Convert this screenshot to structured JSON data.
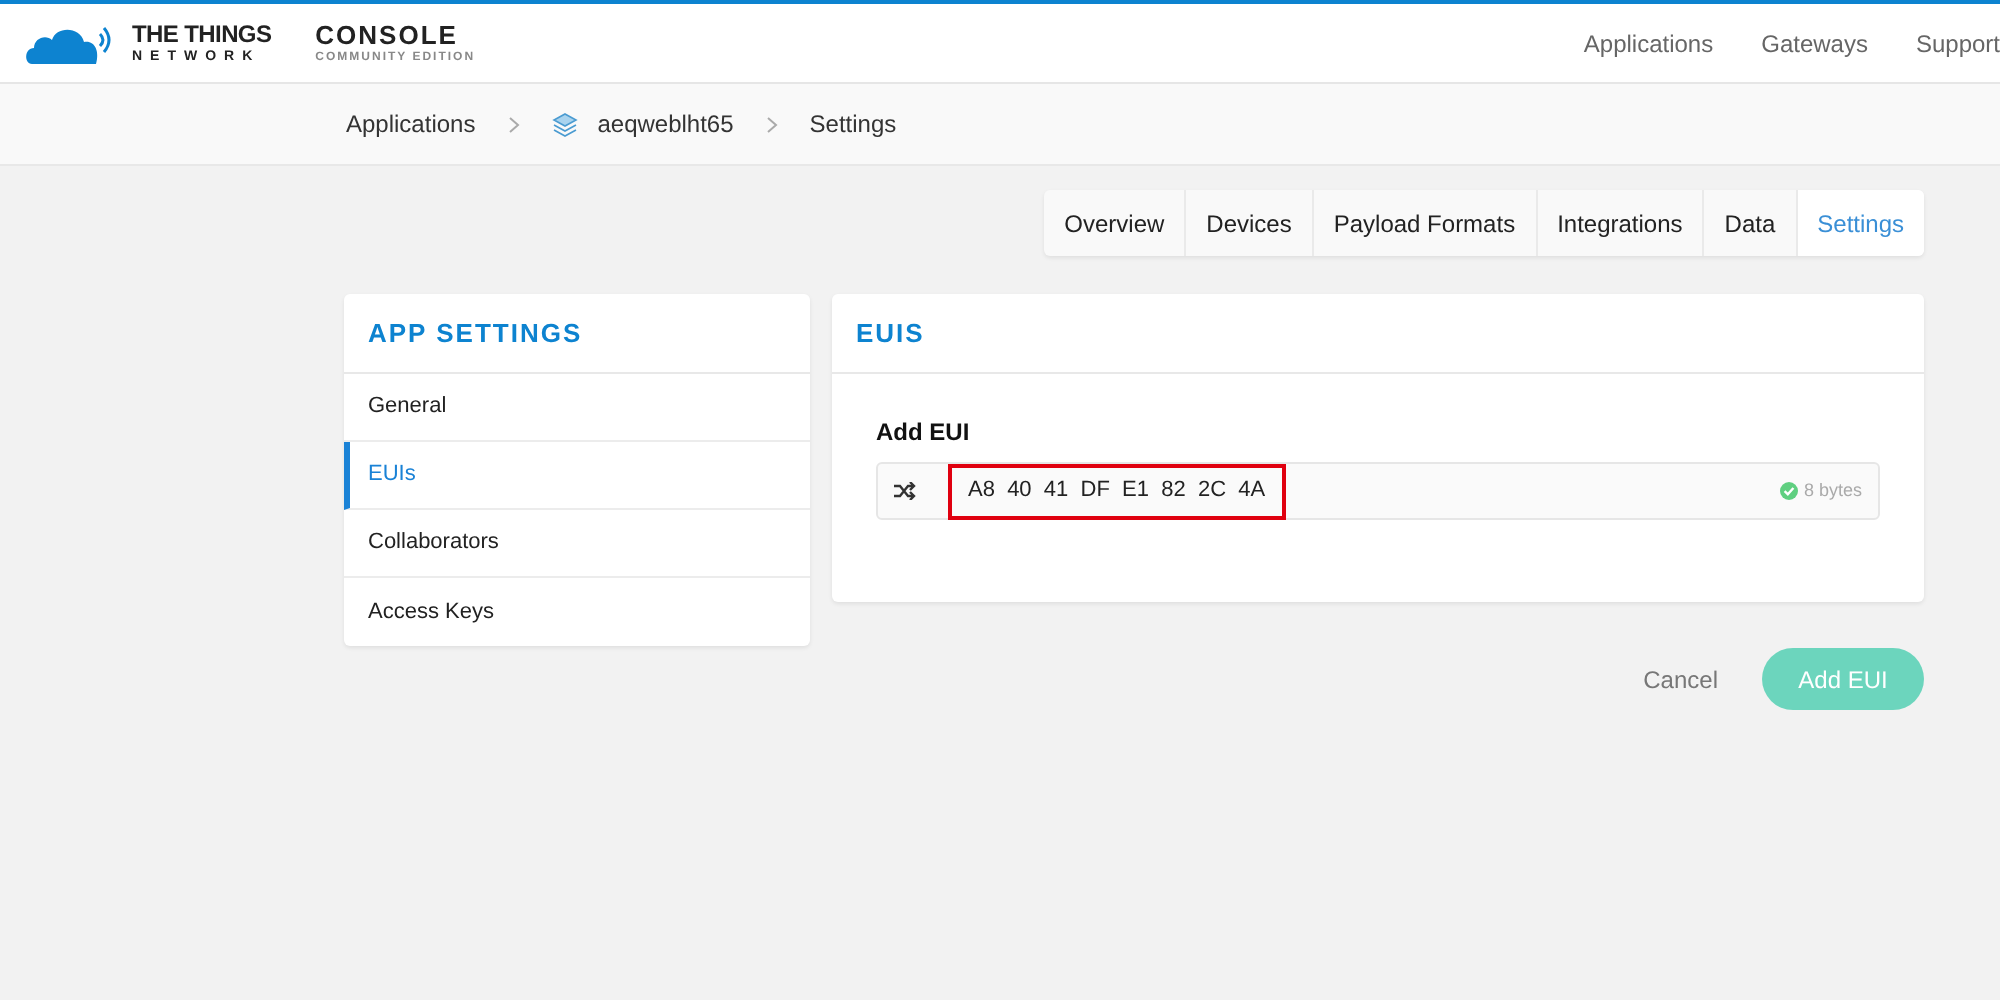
{
  "header": {
    "brand": {
      "line_1": "THE THINGS",
      "line_2": "NETWORK"
    },
    "product": {
      "title": "CONSOLE",
      "subtitle": "COMMUNITY EDITION"
    },
    "nav": [
      "Applications",
      "Gateways",
      "Support"
    ]
  },
  "breadcrumb": [
    "Applications",
    "aeqweblht65",
    "Settings"
  ],
  "tabs": [
    {
      "label": "Overview",
      "selected": false
    },
    {
      "label": "Devices",
      "selected": false
    },
    {
      "label": "Payload Formats",
      "selected": false
    },
    {
      "label": "Integrations",
      "selected": false
    },
    {
      "label": "Data",
      "selected": false
    },
    {
      "label": "Settings",
      "selected": true
    }
  ],
  "sidebar": {
    "title": "APP SETTINGS",
    "items": [
      {
        "label": "General",
        "selected": false
      },
      {
        "label": "EUIs",
        "selected": true
      },
      {
        "label": "Collaborators",
        "selected": false
      },
      {
        "label": "Access Keys",
        "selected": false
      }
    ]
  },
  "panel": {
    "title": "EUIS",
    "field_label": "Add EUI",
    "value": "A8  40  41  DF  E1  82  2C  4A",
    "highlighted": true,
    "length": "8 bytes"
  },
  "buttons": {
    "cancel": "Cancel",
    "submit": "Add EUI"
  }
}
